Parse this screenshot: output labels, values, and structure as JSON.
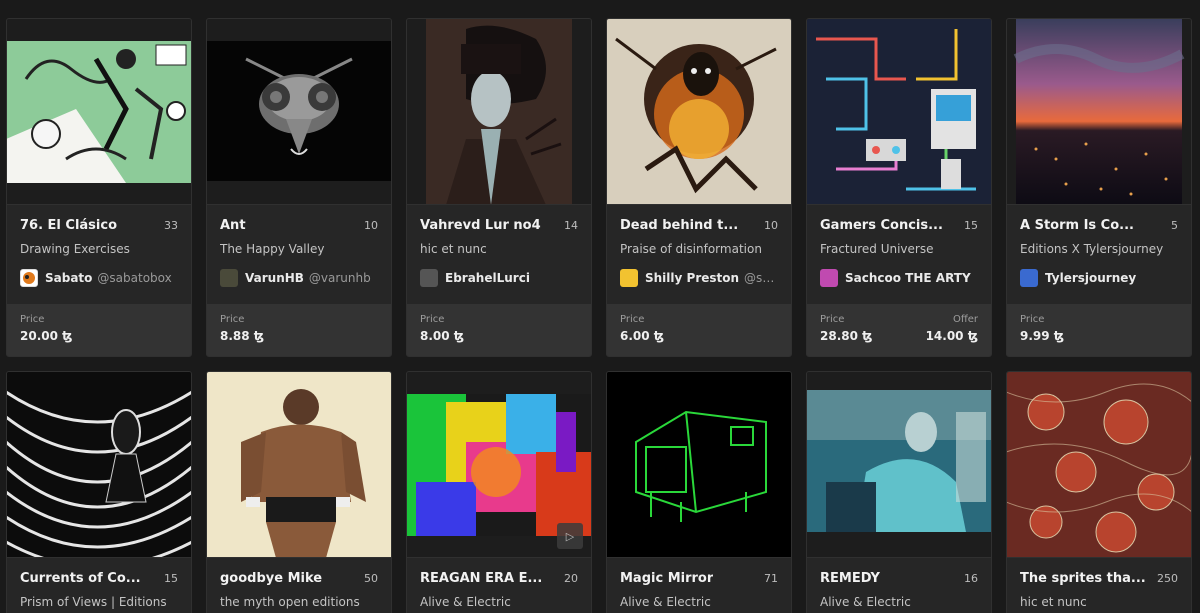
{
  "price_label": "Price",
  "offer_label": "Offer",
  "cards": [
    {
      "title": "76. El Clásico",
      "count": "33",
      "collection": "Drawing Exercises",
      "artist": "Sabato",
      "handle": "@sabatobox",
      "price": "20.00 ꜩ",
      "avatar_color": "#e07a1c",
      "art": "green-comic"
    },
    {
      "title": "Ant",
      "count": "10",
      "collection": "The Happy Valley",
      "artist": "VarunHB",
      "handle": "@varunhb",
      "price": "8.88 ꜩ",
      "avatar_color": "#4a4a3a",
      "art": "ant"
    },
    {
      "title": "Vahrevd Lur no4",
      "count": "14",
      "collection": "hic et nunc",
      "artist": "EbrahelLurci",
      "handle": "",
      "price": "8.00 ꜩ",
      "avatar_color": "#555555",
      "art": "portrait-dark"
    },
    {
      "title": "Dead behind t...",
      "count": "10",
      "collection": "Praise of disinformation",
      "artist": "Shilly Preston",
      "handle": "@shill...",
      "price": "6.00 ꜩ",
      "avatar_color": "#f2c230",
      "art": "fire-figure"
    },
    {
      "title": "Gamers Concis...",
      "count": "15",
      "collection": "Fractured Universe",
      "artist": "Sachcoo THE ARTY",
      "handle": "",
      "price": "28.80 ꜩ",
      "offer": "14.00 ꜩ",
      "avatar_color": "#c04ab0",
      "art": "circuit"
    },
    {
      "title": "A Storm Is Co...",
      "count": "5",
      "collection": "Editions X Tylersjourney",
      "artist": "Tylersjourney",
      "handle": "",
      "price": "9.99 ꜩ",
      "avatar_color": "#3a6ad0",
      "art": "city-sunset"
    },
    {
      "title": "Currents of Co...",
      "count": "15",
      "collection": "Prism of Views | Editions",
      "art": "swirl"
    },
    {
      "title": "goodbye Mike",
      "count": "50",
      "collection": "the myth open editions",
      "art": "boxer"
    },
    {
      "title": "REAGAN ERA E...",
      "count": "20",
      "collection": "Alive & Electric",
      "art": "psychedelic",
      "play_icon": "play-icon"
    },
    {
      "title": "Magic Mirror",
      "count": "71",
      "collection": "Alive & Electric",
      "art": "neon-tv"
    },
    {
      "title": "REMEDY",
      "count": "16",
      "collection": "Alive & Electric",
      "art": "glitch-photo"
    },
    {
      "title": "The sprites tha...",
      "count": "250",
      "collection": "hic et nunc",
      "art": "red-sprites"
    }
  ]
}
